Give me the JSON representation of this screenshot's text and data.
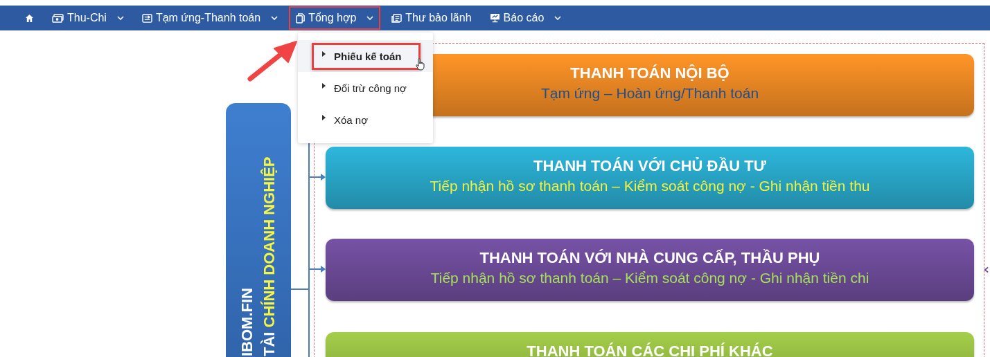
{
  "navbar": {
    "items": [
      {
        "kind": "home",
        "has_menu": false,
        "annotated": false
      },
      {
        "kind": "money",
        "label": "Thu-Chi",
        "has_menu": true,
        "annotated": false
      },
      {
        "kind": "transfer",
        "label": "Tạm ứng-Thanh toán",
        "has_menu": true,
        "annotated": false
      },
      {
        "kind": "document",
        "label": "Tổng hợp",
        "has_menu": true,
        "annotated": true
      },
      {
        "kind": "letters",
        "label": "Thư bảo lãnh",
        "has_menu": false,
        "annotated": false
      },
      {
        "kind": "monitor",
        "label": "Báo cáo",
        "has_menu": true,
        "annotated": false
      }
    ]
  },
  "dropdown": {
    "items": [
      {
        "label": "Phiếu kế toán",
        "selected": true,
        "annotated": true
      },
      {
        "label": "Đối trừ công nợ",
        "selected": false,
        "annotated": false
      },
      {
        "label": "Xóa nợ",
        "selected": false,
        "annotated": false
      }
    ]
  },
  "diagram": {
    "root": {
      "line_1": "IBOM.FIN",
      "line_2": [
        {
          "text": "TÀI",
          "color": "#ffffff"
        },
        {
          "text": "CHÍNH DOANH NGHIỆP",
          "color": "#f5f542"
        }
      ]
    },
    "cards": [
      {
        "title": "THANH TOÁN NỘI BỘ",
        "subtitle": {
          "text": "Tạm ứng – Hoàn ứng/Thanh toán",
          "color": "#1f4e8c"
        },
        "color": "#f08a24",
        "arrow": false
      },
      {
        "title": "THANH TOÁN VỚI CHỦ ĐẦU TƯ",
        "subtitle": {
          "text": "Tiếp nhận hồ sơ thanh toán – Kiểm soát công nợ - Ghi nhận tiền thu",
          "color": "#f2f23a"
        },
        "color": "#2aa9cc",
        "arrow": true
      },
      {
        "title": "THANH TOÁN VỚI NHÀ CUNG CẤP, THẦU PHỤ",
        "subtitle": {
          "text": "Tiếp nhận hồ sơ thanh toán – Kiểm soát công nợ - Ghi nhận tiền chi",
          "color": "#a6e05a"
        },
        "color": "#6e4c9a",
        "arrow": true
      },
      {
        "title": "THANH TOÁN CÁC CHI PHÍ KHÁC",
        "color": "#98c044",
        "arrow": false
      }
    ]
  }
}
